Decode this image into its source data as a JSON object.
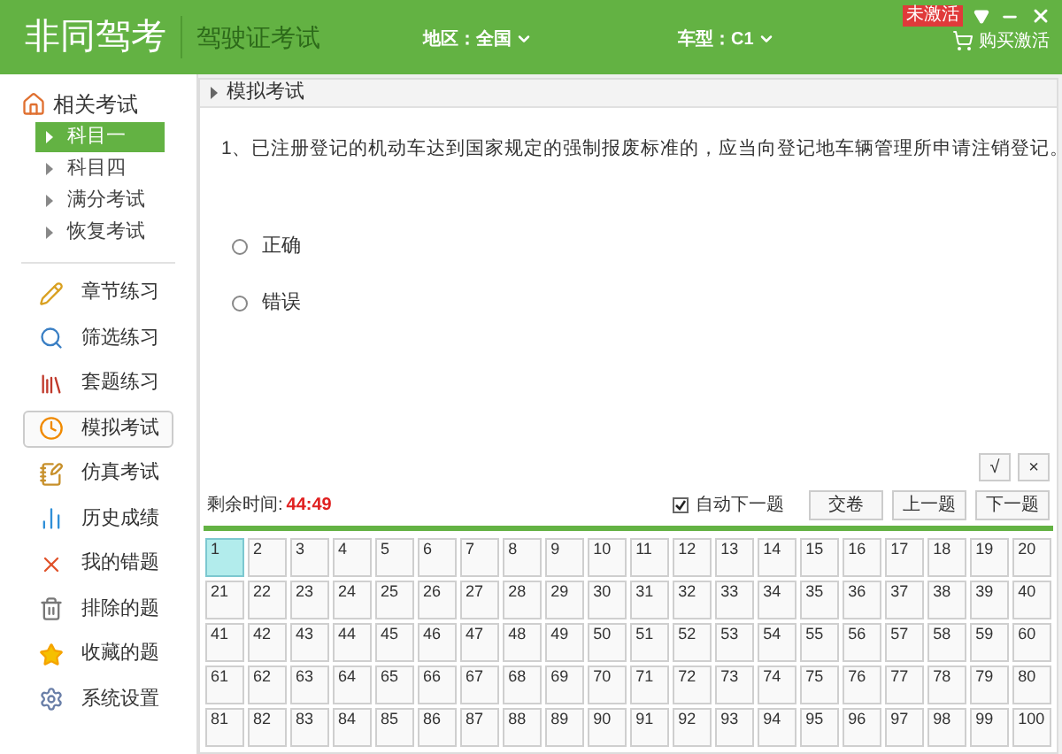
{
  "header": {
    "app_title": "非同驾考",
    "subtitle": "驾驶证考试",
    "region": "地区：全国",
    "car_type": "车型：C1",
    "purchase": "购买激活",
    "activation_badge": "未激活"
  },
  "sidebar": {
    "section_title": "相关考试",
    "subjects": [
      {
        "label": "科目一",
        "selected": true
      },
      {
        "label": "科目四",
        "selected": false
      },
      {
        "label": "满分考试",
        "selected": false
      },
      {
        "label": "恢复考试",
        "selected": false
      }
    ],
    "menu": [
      {
        "label": "章节练习",
        "selected": false
      },
      {
        "label": "筛选练习",
        "selected": false
      },
      {
        "label": "套题练习",
        "selected": false
      },
      {
        "label": "模拟考试",
        "selected": true
      },
      {
        "label": "仿真考试",
        "selected": false
      },
      {
        "label": "历史成绩",
        "selected": false
      },
      {
        "label": "我的错题",
        "selected": false
      },
      {
        "label": "排除的题",
        "selected": false
      },
      {
        "label": "收藏的题",
        "selected": false
      },
      {
        "label": "系统设置",
        "selected": false
      }
    ]
  },
  "breadcrumb": "模拟考试",
  "question": "1、已注册登记的机动车达到国家规定的强制报废标准的，应当向登记地车辆管理所申请注销登记。",
  "options": [
    {
      "label": "正确",
      "selected": false
    },
    {
      "label": "错误",
      "selected": false
    }
  ],
  "answer_buttons": [
    "√",
    "×"
  ],
  "timer": {
    "label": "剩余时间:",
    "value": "44:49"
  },
  "auto_next": {
    "label": "自动下一题",
    "checked": true
  },
  "nav_buttons": [
    "交卷",
    "上一题",
    "下一题"
  ],
  "question_numbers": [
    {
      "number": "1",
      "selected": true
    },
    {
      "number": "2",
      "selected": false
    },
    {
      "number": "3",
      "selected": false
    },
    {
      "number": "4",
      "selected": false
    },
    {
      "number": "5",
      "selected": false
    },
    {
      "number": "6",
      "selected": false
    },
    {
      "number": "7",
      "selected": false
    },
    {
      "number": "8",
      "selected": false
    },
    {
      "number": "9",
      "selected": false
    },
    {
      "number": "10",
      "selected": false
    },
    {
      "number": "11",
      "selected": false
    },
    {
      "number": "12",
      "selected": false
    },
    {
      "number": "13",
      "selected": false
    },
    {
      "number": "14",
      "selected": false
    },
    {
      "number": "15",
      "selected": false
    },
    {
      "number": "16",
      "selected": false
    },
    {
      "number": "17",
      "selected": false
    },
    {
      "number": "18",
      "selected": false
    },
    {
      "number": "19",
      "selected": false
    },
    {
      "number": "20",
      "selected": false
    },
    {
      "number": "21",
      "selected": false
    },
    {
      "number": "22",
      "selected": false
    },
    {
      "number": "23",
      "selected": false
    },
    {
      "number": "24",
      "selected": false
    },
    {
      "number": "25",
      "selected": false
    },
    {
      "number": "26",
      "selected": false
    },
    {
      "number": "27",
      "selected": false
    },
    {
      "number": "28",
      "selected": false
    },
    {
      "number": "29",
      "selected": false
    },
    {
      "number": "30",
      "selected": false
    },
    {
      "number": "31",
      "selected": false
    },
    {
      "number": "32",
      "selected": false
    },
    {
      "number": "33",
      "selected": false
    },
    {
      "number": "34",
      "selected": false
    },
    {
      "number": "35",
      "selected": false
    },
    {
      "number": "36",
      "selected": false
    },
    {
      "number": "37",
      "selected": false
    },
    {
      "number": "38",
      "selected": false
    },
    {
      "number": "39",
      "selected": false
    },
    {
      "number": "40",
      "selected": false
    },
    {
      "number": "41",
      "selected": false
    },
    {
      "number": "42",
      "selected": false
    },
    {
      "number": "43",
      "selected": false
    },
    {
      "number": "44",
      "selected": false
    },
    {
      "number": "45",
      "selected": false
    },
    {
      "number": "46",
      "selected": false
    },
    {
      "number": "47",
      "selected": false
    },
    {
      "number": "48",
      "selected": false
    },
    {
      "number": "49",
      "selected": false
    },
    {
      "number": "50",
      "selected": false
    },
    {
      "number": "51",
      "selected": false
    },
    {
      "number": "52",
      "selected": false
    },
    {
      "number": "53",
      "selected": false
    },
    {
      "number": "54",
      "selected": false
    },
    {
      "number": "55",
      "selected": false
    },
    {
      "number": "56",
      "selected": false
    },
    {
      "number": "57",
      "selected": false
    },
    {
      "number": "58",
      "selected": false
    },
    {
      "number": "59",
      "selected": false
    },
    {
      "number": "60",
      "selected": false
    },
    {
      "number": "61",
      "selected": false
    },
    {
      "number": "62",
      "selected": false
    },
    {
      "number": "63",
      "selected": false
    },
    {
      "number": "64",
      "selected": false
    },
    {
      "number": "65",
      "selected": false
    },
    {
      "number": "66",
      "selected": false
    },
    {
      "number": "67",
      "selected": false
    },
    {
      "number": "68",
      "selected": false
    },
    {
      "number": "69",
      "selected": false
    },
    {
      "number": "70",
      "selected": false
    },
    {
      "number": "71",
      "selected": false
    },
    {
      "number": "72",
      "selected": false
    },
    {
      "number": "73",
      "selected": false
    },
    {
      "number": "74",
      "selected": false
    },
    {
      "number": "75",
      "selected": false
    },
    {
      "number": "76",
      "selected": false
    },
    {
      "number": "77",
      "selected": false
    },
    {
      "number": "78",
      "selected": false
    },
    {
      "number": "79",
      "selected": false
    },
    {
      "number": "80",
      "selected": false
    },
    {
      "number": "81",
      "selected": false
    },
    {
      "number": "82",
      "selected": false
    },
    {
      "number": "83",
      "selected": false
    },
    {
      "number": "84",
      "selected": false
    },
    {
      "number": "85",
      "selected": false
    },
    {
      "number": "86",
      "selected": false
    },
    {
      "number": "87",
      "selected": false
    },
    {
      "number": "88",
      "selected": false
    },
    {
      "number": "89",
      "selected": false
    },
    {
      "number": "90",
      "selected": false
    },
    {
      "number": "91",
      "selected": false
    },
    {
      "number": "92",
      "selected": false
    },
    {
      "number": "93",
      "selected": false
    },
    {
      "number": "94",
      "selected": false
    },
    {
      "number": "95",
      "selected": false
    },
    {
      "number": "96",
      "selected": false
    },
    {
      "number": "97",
      "selected": false
    },
    {
      "number": "98",
      "selected": false
    },
    {
      "number": "99",
      "selected": false
    },
    {
      "number": "100",
      "selected": false
    }
  ]
}
